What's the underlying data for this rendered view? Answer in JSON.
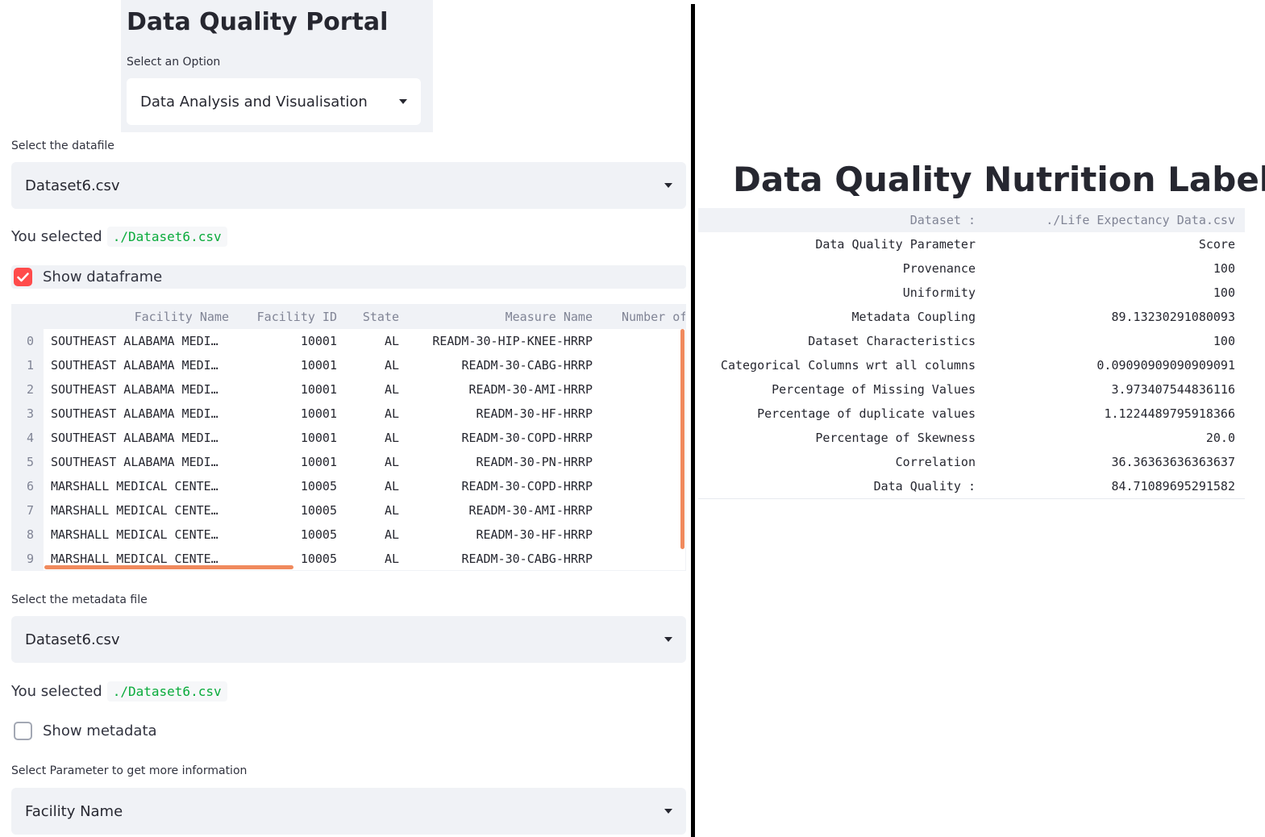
{
  "sidebar": {
    "title": "Data Quality Portal",
    "option_label": "Select an Option",
    "option_value": "Data Analysis and Visualisation"
  },
  "datafile": {
    "label": "Select the datafile",
    "value": "Dataset6.csv",
    "selected_prefix": "You selected",
    "selected_path": "./Dataset6.csv",
    "show_label": "Show dataframe",
    "show_checked": true
  },
  "dataframe": {
    "columns": [
      "Facility Name",
      "Facility ID",
      "State",
      "Measure Name",
      "Number of"
    ],
    "rows": [
      {
        "index": "0",
        "facility_name": "SOUTHEAST ALABAMA MEDI…",
        "facility_id": "10001",
        "state": "AL",
        "measure": "READM-30-HIP-KNEE-HRRP"
      },
      {
        "index": "1",
        "facility_name": "SOUTHEAST ALABAMA MEDI…",
        "facility_id": "10001",
        "state": "AL",
        "measure": "READM-30-CABG-HRRP"
      },
      {
        "index": "2",
        "facility_name": "SOUTHEAST ALABAMA MEDI…",
        "facility_id": "10001",
        "state": "AL",
        "measure": "READM-30-AMI-HRRP"
      },
      {
        "index": "3",
        "facility_name": "SOUTHEAST ALABAMA MEDI…",
        "facility_id": "10001",
        "state": "AL",
        "measure": "READM-30-HF-HRRP"
      },
      {
        "index": "4",
        "facility_name": "SOUTHEAST ALABAMA MEDI…",
        "facility_id": "10001",
        "state": "AL",
        "measure": "READM-30-COPD-HRRP"
      },
      {
        "index": "5",
        "facility_name": "SOUTHEAST ALABAMA MEDI…",
        "facility_id": "10001",
        "state": "AL",
        "measure": "READM-30-PN-HRRP"
      },
      {
        "index": "6",
        "facility_name": "MARSHALL MEDICAL CENTE…",
        "facility_id": "10005",
        "state": "AL",
        "measure": "READM-30-COPD-HRRP"
      },
      {
        "index": "7",
        "facility_name": "MARSHALL MEDICAL CENTE…",
        "facility_id": "10005",
        "state": "AL",
        "measure": "READM-30-AMI-HRRP"
      },
      {
        "index": "8",
        "facility_name": "MARSHALL MEDICAL CENTE…",
        "facility_id": "10005",
        "state": "AL",
        "measure": "READM-30-HF-HRRP"
      },
      {
        "index": "9",
        "facility_name": "MARSHALL MEDICAL CENTE…",
        "facility_id": "10005",
        "state": "AL",
        "measure": "READM-30-CABG-HRRP"
      }
    ]
  },
  "metadata": {
    "label": "Select the metadata file",
    "value": "Dataset6.csv",
    "selected_prefix": "You selected",
    "selected_path": "./Dataset6.csv",
    "show_label": "Show metadata",
    "show_checked": false
  },
  "parameter": {
    "label": "Select Parameter to get more information",
    "value": "Facility Name"
  },
  "nutrition_label": {
    "title": "Data Quality Nutrition Label",
    "header": {
      "param": "Dataset :",
      "score": "./Life Expectancy Data.csv"
    },
    "rows": [
      {
        "param": "Data Quality Parameter",
        "score": "Score"
      },
      {
        "param": "Provenance",
        "score": "100"
      },
      {
        "param": "Uniformity",
        "score": "100"
      },
      {
        "param": "Metadata Coupling",
        "score": "89.13230291080093"
      },
      {
        "param": "Dataset Characteristics",
        "score": "100"
      },
      {
        "param": "Categorical Columns wrt all columns",
        "score": "0.09090909090909091"
      },
      {
        "param": "Percentage of Missing Values",
        "score": "3.973407544836116"
      },
      {
        "param": "Percentage of duplicate values",
        "score": "1.1224489795918366"
      },
      {
        "param": "Percentage of Skewness",
        "score": "20.0"
      },
      {
        "param": "Correlation",
        "score": "36.36363636363637"
      },
      {
        "param": "Data Quality :",
        "score": "84.71089695291582"
      }
    ]
  },
  "colors": {
    "accent": "#ff4b4b",
    "code_green": "#09ab3b",
    "scrollbar": "#f08a5d",
    "panel_bg": "#f0f2f6"
  }
}
